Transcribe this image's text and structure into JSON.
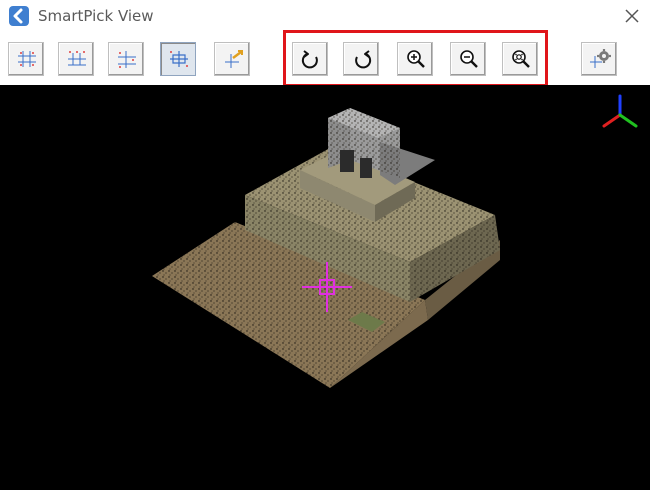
{
  "window": {
    "title": "SmartPick View",
    "icon": "app-logo-icon",
    "close_icon": "close-icon"
  },
  "toolbar": {
    "buttons": [
      {
        "icon": "view-top-icon",
        "pressed": false
      },
      {
        "icon": "view-front-icon",
        "pressed": false
      },
      {
        "icon": "view-side-icon",
        "pressed": false
      },
      {
        "icon": "view-iso-icon",
        "pressed": true
      },
      {
        "icon": "pan-view-icon",
        "pressed": false
      },
      {
        "icon": "rotate-clockwise-icon",
        "pressed": false
      },
      {
        "icon": "rotate-counterclockwise-icon",
        "pressed": false
      },
      {
        "icon": "zoom-in-icon",
        "pressed": false
      },
      {
        "icon": "zoom-out-icon",
        "pressed": false
      },
      {
        "icon": "zoom-fit-icon",
        "pressed": false
      },
      {
        "icon": "settings-icon",
        "pressed": false
      }
    ]
  },
  "colors": {
    "highlight": "#e0151a",
    "crosshair": "#e030e0",
    "viewport_background": "#000000",
    "axis_x": "#e02020",
    "axis_y": "#20c020",
    "axis_z": "#2040ff"
  }
}
